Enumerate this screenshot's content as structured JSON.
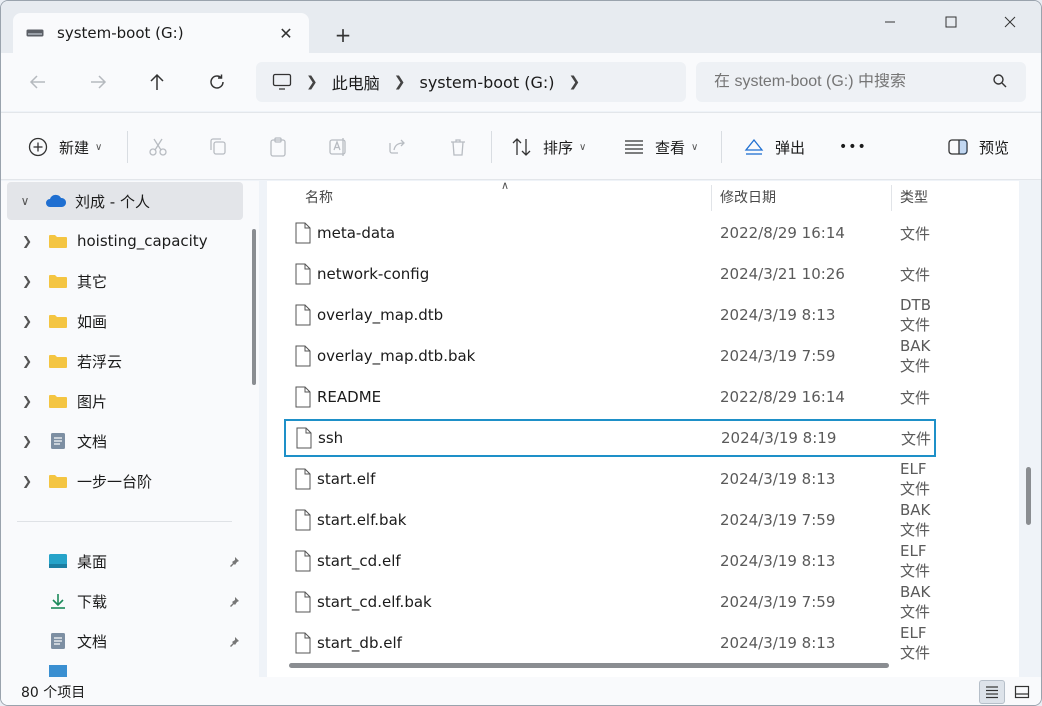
{
  "window": {
    "tab_title": "system-boot (G:)",
    "tab_close": "✕",
    "new_tab": "+",
    "minimize": "—",
    "maximize": "☐",
    "close": "✕"
  },
  "address": {
    "crumbs": [
      "此电脑",
      "system-boot (G:)"
    ],
    "search_placeholder": "在 system-boot (G:) 中搜索"
  },
  "toolbar": {
    "new_label": "新建",
    "sort_label": "排序",
    "view_label": "查看",
    "eject_label": "弹出",
    "more_label": "•••",
    "preview_label": "预览"
  },
  "nav": {
    "account": "刘成 - 个人",
    "folders": [
      "hoisting_capacity",
      "其它",
      "如画",
      "若浮云",
      "图片",
      "文档",
      "一步一台阶"
    ],
    "quick": [
      "桌面",
      "下载",
      "文档"
    ]
  },
  "columns": {
    "name": "名称",
    "date": "修改日期",
    "type": "类型"
  },
  "files": [
    {
      "name": "meta-data",
      "date": "2022/8/29 16:14",
      "type": "文件"
    },
    {
      "name": "network-config",
      "date": "2024/3/21 10:26",
      "type": "文件"
    },
    {
      "name": "overlay_map.dtb",
      "date": "2024/3/19 8:13",
      "type": "DTB 文件"
    },
    {
      "name": "overlay_map.dtb.bak",
      "date": "2024/3/19 7:59",
      "type": "BAK 文件"
    },
    {
      "name": "README",
      "date": "2022/8/29 16:14",
      "type": "文件"
    },
    {
      "name": "ssh",
      "date": "2024/3/19 8:19",
      "type": "文件"
    },
    {
      "name": "start.elf",
      "date": "2024/3/19 8:13",
      "type": "ELF 文件"
    },
    {
      "name": "start.elf.bak",
      "date": "2024/3/19 7:59",
      "type": "BAK 文件"
    },
    {
      "name": "start_cd.elf",
      "date": "2024/3/19 8:13",
      "type": "ELF 文件"
    },
    {
      "name": "start_cd.elf.bak",
      "date": "2024/3/19 7:59",
      "type": "BAK 文件"
    },
    {
      "name": "start_db.elf",
      "date": "2024/3/19 8:13",
      "type": "ELF 文件"
    }
  ],
  "focused_file": "ssh",
  "status": {
    "item_count": "80 个项目"
  },
  "colors": {
    "accent": "#1e90c8",
    "folder": "#f4c542",
    "onedrive": "#1f6fd1"
  }
}
